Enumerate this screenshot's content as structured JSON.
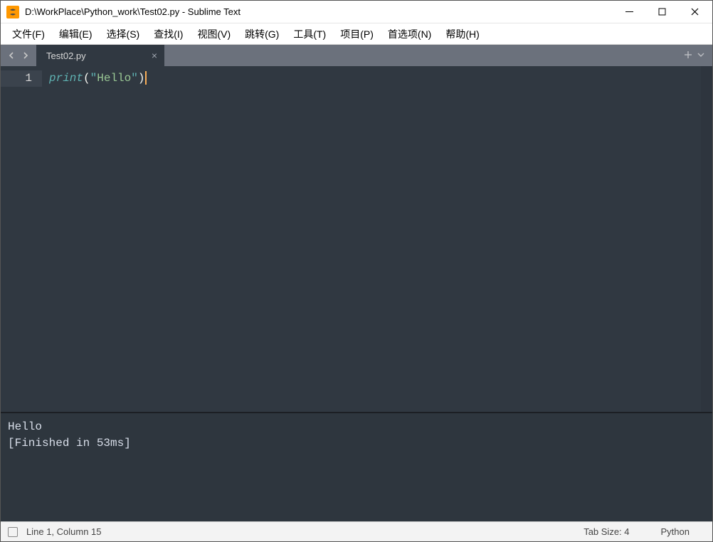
{
  "title": "D:\\WorkPlace\\Python_work\\Test02.py - Sublime Text",
  "menu": [
    "文件(F)",
    "编辑(E)",
    "选择(S)",
    "查找(I)",
    "视图(V)",
    "跳转(G)",
    "工具(T)",
    "项目(P)",
    "首选项(N)",
    "帮助(H)"
  ],
  "tab": {
    "label": "Test02.py"
  },
  "editor": {
    "line_number": "1",
    "code": {
      "func": "print",
      "lparen": "(",
      "quote1": "\"",
      "str": "Hello",
      "quote2": "\"",
      "rparen": ")"
    }
  },
  "output": {
    "line1": "Hello",
    "line2": "[Finished in 53ms]"
  },
  "status": {
    "pos": "Line 1, Column 15",
    "tab_size": "Tab Size: 4",
    "lang": "Python"
  }
}
